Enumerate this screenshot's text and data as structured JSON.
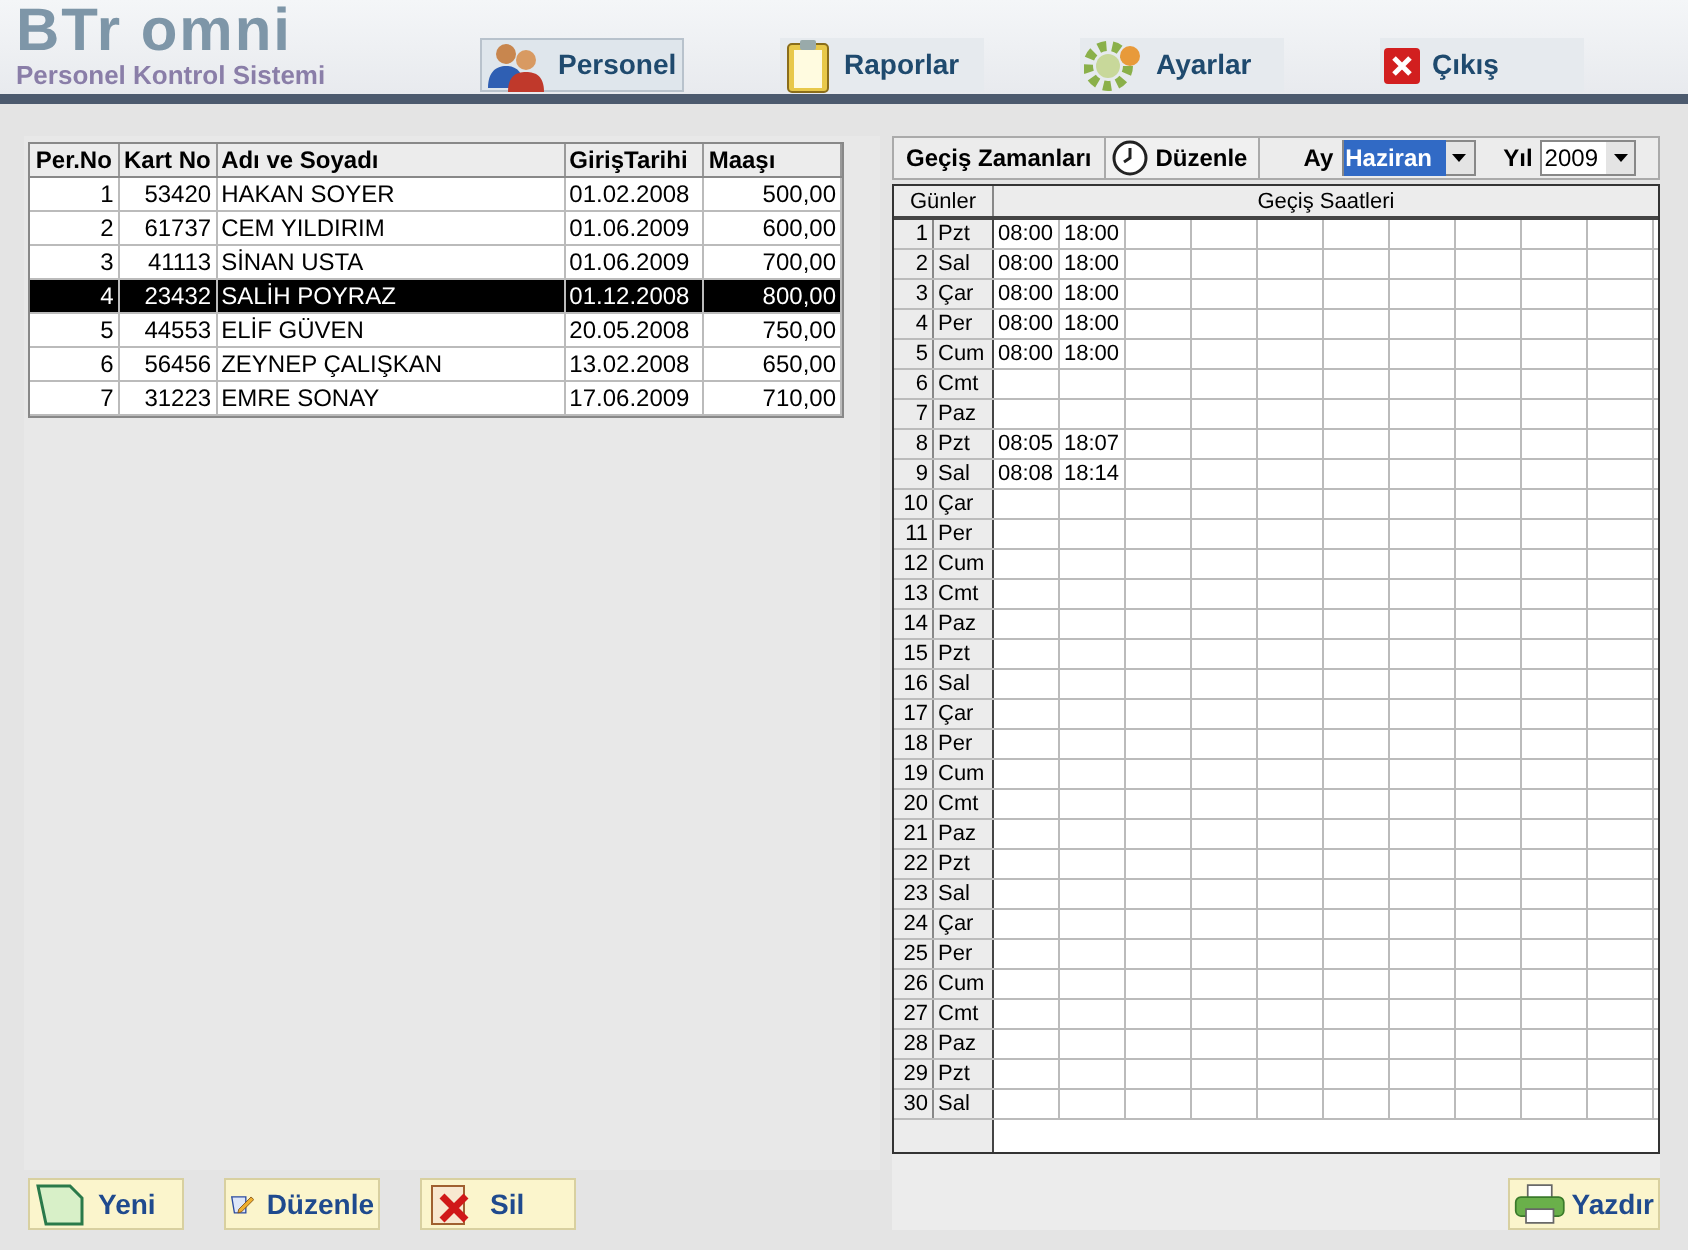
{
  "app": {
    "logo": "BTr omni",
    "subtitle": "Personel Kontrol Sistemi"
  },
  "nav": [
    {
      "label": "Personel",
      "selected": true
    },
    {
      "label": "Raporlar",
      "selected": false
    },
    {
      "label": "Ayarlar",
      "selected": false
    },
    {
      "label": "Çıkış",
      "selected": false
    }
  ],
  "staff_table": {
    "columns": [
      "Per.No",
      "Kart No",
      "Adı ve Soyadı",
      "GirişTarihi",
      "Maaşı"
    ],
    "rows": [
      {
        "cells": [
          "1",
          "53420",
          "HAKAN SOYER",
          "01.02.2008",
          "500,00"
        ],
        "selected": false
      },
      {
        "cells": [
          "2",
          "61737",
          "CEM YILDIRIM",
          "01.06.2009",
          "600,00"
        ],
        "selected": false
      },
      {
        "cells": [
          "3",
          "41113",
          "SİNAN USTA",
          "01.06.2009",
          "700,00"
        ],
        "selected": false
      },
      {
        "cells": [
          "4",
          "23432",
          "SALİH POYRAZ",
          "01.12.2008",
          "800,00"
        ],
        "selected": true
      },
      {
        "cells": [
          "5",
          "44553",
          "ELİF GÜVEN",
          "20.05.2008",
          "750,00"
        ],
        "selected": false
      },
      {
        "cells": [
          "6",
          "56456",
          "ZEYNEP ÇALIŞKAN",
          "13.02.2008",
          "650,00"
        ],
        "selected": false
      },
      {
        "cells": [
          "7",
          "31223",
          "EMRE SONAY",
          "17.06.2009",
          "710,00"
        ],
        "selected": false
      }
    ]
  },
  "left_buttons": [
    "Yeni",
    "Düzenle",
    "Sil"
  ],
  "passes": {
    "title": "Geçiş Zamanları",
    "edit_button": "Düzenle",
    "month_label": "Ay",
    "month": "Haziran",
    "year_label": "Yıl",
    "year": "2009",
    "columns": [
      "Günler",
      "Geçiş Saatleri"
    ],
    "days": [
      {
        "day": "1",
        "name": "Pzt",
        "times": [
          "08:00",
          "18:00"
        ]
      },
      {
        "day": "2",
        "name": "Sal",
        "times": [
          "08:00",
          "18:00"
        ]
      },
      {
        "day": "3",
        "name": "Çar",
        "times": [
          "08:00",
          "18:00"
        ]
      },
      {
        "day": "4",
        "name": "Per",
        "times": [
          "08:00",
          "18:00"
        ]
      },
      {
        "day": "5",
        "name": "Cum",
        "times": [
          "08:00",
          "18:00"
        ]
      },
      {
        "day": "6",
        "name": "Cmt"
      },
      {
        "day": "7",
        "name": "Paz"
      },
      {
        "day": "8",
        "name": "Pzt",
        "times": [
          "08:05",
          "18:07"
        ]
      },
      {
        "day": "9",
        "name": "Sal",
        "times": [
          "08:08",
          "18:14"
        ]
      },
      {
        "day": "10",
        "name": "Çar"
      },
      {
        "day": "11",
        "name": "Per"
      },
      {
        "day": "12",
        "name": "Cum"
      },
      {
        "day": "13",
        "name": "Cmt"
      },
      {
        "day": "14",
        "name": "Paz"
      },
      {
        "day": "15",
        "name": "Pzt"
      },
      {
        "day": "16",
        "name": "Sal"
      },
      {
        "day": "17",
        "name": "Çar"
      },
      {
        "day": "18",
        "name": "Per"
      },
      {
        "day": "19",
        "name": "Cum"
      },
      {
        "day": "20",
        "name": "Cmt"
      },
      {
        "day": "21",
        "name": "Paz"
      },
      {
        "day": "22",
        "name": "Pzt"
      },
      {
        "day": "23",
        "name": "Sal"
      },
      {
        "day": "24",
        "name": "Çar"
      },
      {
        "day": "25",
        "name": "Per"
      },
      {
        "day": "26",
        "name": "Cum"
      },
      {
        "day": "27",
        "name": "Cmt"
      },
      {
        "day": "28",
        "name": "Paz"
      },
      {
        "day": "29",
        "name": "Pzt"
      },
      {
        "day": "30",
        "name": "Sal"
      }
    ]
  },
  "print_button": "Yazdır"
}
